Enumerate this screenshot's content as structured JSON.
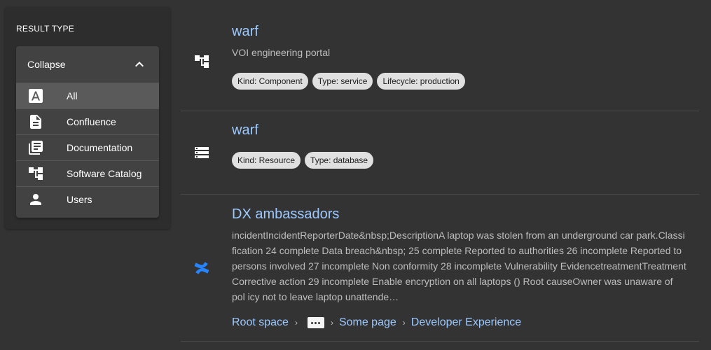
{
  "sidebar": {
    "title": "RESULT TYPE",
    "collapse_label": "Collapse",
    "items": [
      {
        "label": "All",
        "icon": "font-letter-a-icon",
        "selected": true
      },
      {
        "label": "Confluence",
        "icon": "document-icon",
        "selected": false
      },
      {
        "label": "Documentation",
        "icon": "library-books-icon",
        "selected": false
      },
      {
        "label": "Software Catalog",
        "icon": "account-tree-icon",
        "selected": false
      },
      {
        "label": "Users",
        "icon": "person-icon",
        "selected": false
      }
    ]
  },
  "results": [
    {
      "icon": "account-tree-icon",
      "title": "warf",
      "subtitle": "VOI engineering portal",
      "chips": [
        "Kind: Component",
        "Type: service",
        "Lifecycle: production"
      ]
    },
    {
      "icon": "storage-icon",
      "title": "warf",
      "chips": [
        "Kind: Resource",
        "Type: database"
      ]
    },
    {
      "icon": "confluence-icon",
      "title": "DX ambassadors",
      "excerpt": "incidentIncidentReporterDate&nbsp;DescriptionA laptop was stolen from an underground car park.Classi fication 24 complete Data breach&nbsp; 25 complete Reported to authorities 26 incomplete Reported to persons involved 27 incomplete Non conformity 28 incomplete Vulnerability EvidencetreatmentTreatment Corrective action 29 incomplete Enable encryption on all laptops () Root causeOwner was unaware of pol icy not to leave laptop unattende…",
      "breadcrumb": [
        "Root space",
        "Some page",
        "Developer Experience"
      ]
    }
  ],
  "colors": {
    "background": "#333333",
    "panel": "#424242",
    "link": "#9cc9ff",
    "chip": "#e0e0e0",
    "confluence_blue": "#2684ff"
  }
}
